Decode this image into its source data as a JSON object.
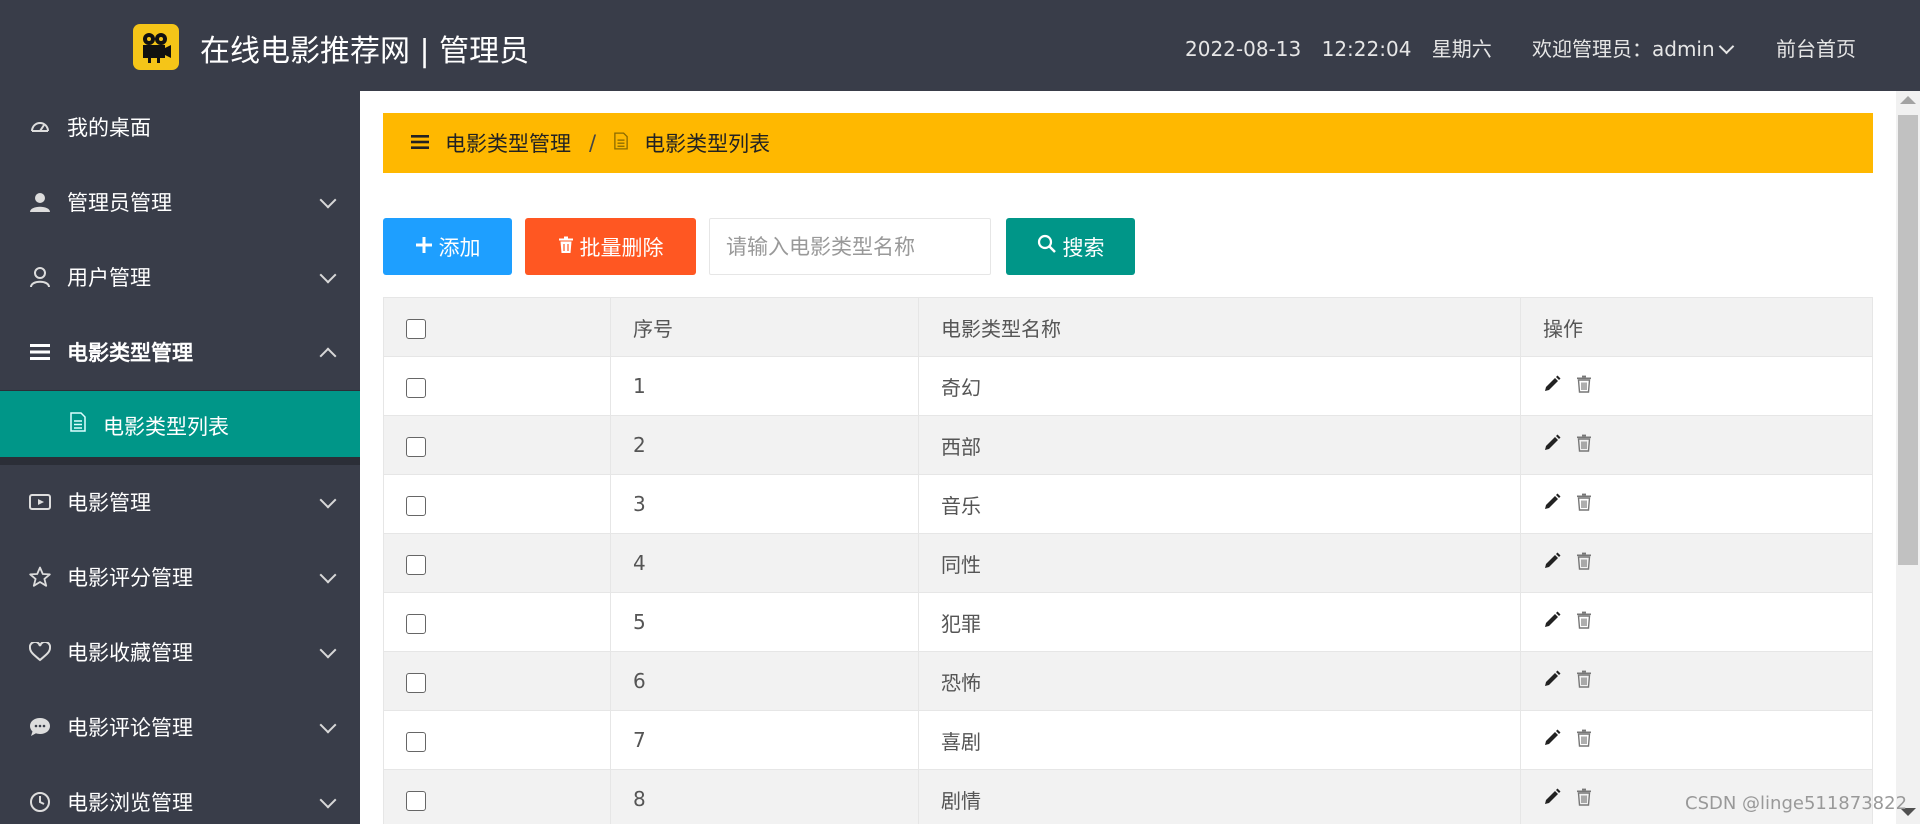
{
  "header": {
    "app_title": "在线电影推荐网 | 管理员",
    "date": "2022-08-13",
    "time": "12:22:04",
    "weekday": "星期六",
    "welcome": "欢迎管理员：admin",
    "home_link": "前台首页",
    "logo_icon": "film-camera-icon",
    "logo_color": "#f5c518"
  },
  "sidebar": {
    "items": [
      {
        "label": "我的桌面",
        "icon": "dashboard-icon"
      },
      {
        "label": "管理员管理",
        "icon": "user-filled-icon"
      },
      {
        "label": "用户管理",
        "icon": "user-outline-icon"
      },
      {
        "label": "电影类型管理",
        "icon": "menu-icon"
      },
      {
        "label": "电影管理",
        "icon": "video-icon"
      },
      {
        "label": "电影评分管理",
        "icon": "star-icon"
      },
      {
        "label": "电影收藏管理",
        "icon": "heart-icon"
      },
      {
        "label": "电影评论管理",
        "icon": "comment-icon"
      },
      {
        "label": "电影浏览管理",
        "icon": "clock-icon"
      }
    ],
    "sub_item": {
      "label": "电影类型列表",
      "icon": "document-icon"
    },
    "active_color": "#009688"
  },
  "breadcrumb": {
    "parent": "电影类型管理",
    "separator": "/",
    "current": "电影类型列表",
    "color": "#ffb800"
  },
  "toolbar": {
    "add_label": "添加",
    "batch_delete_label": "批量删除",
    "search_placeholder": "请输入电影类型名称",
    "search_value": "",
    "search_label": "搜索"
  },
  "table": {
    "columns": [
      "序号",
      "电影类型名称",
      "操作"
    ],
    "rows": [
      {
        "index": "1",
        "name": "奇幻"
      },
      {
        "index": "2",
        "name": "西部"
      },
      {
        "index": "3",
        "name": "音乐"
      },
      {
        "index": "4",
        "name": "同性"
      },
      {
        "index": "5",
        "name": "犯罪"
      },
      {
        "index": "6",
        "name": "恐怖"
      },
      {
        "index": "7",
        "name": "喜剧"
      },
      {
        "index": "8",
        "name": "剧情"
      }
    ]
  },
  "watermark": "CSDN @linge511873822"
}
